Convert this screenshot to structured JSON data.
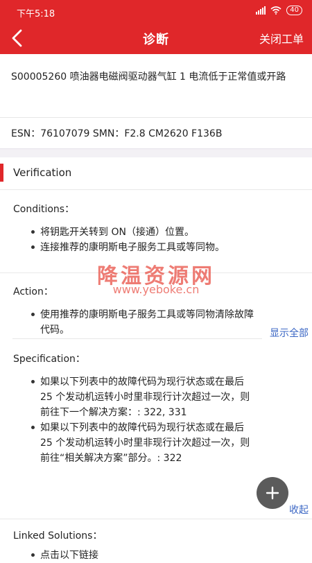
{
  "status": {
    "time": "下午5:18",
    "battery": "40"
  },
  "header": {
    "title": "诊断",
    "close_label": "关闭工单"
  },
  "fault": {
    "description": "S00005260 喷油器电磁阀驱动器气缸 1 电流低于正常值或开路",
    "esn_line": "ESN：76107079 SMN：F2.8 CM2620 F136B"
  },
  "section": {
    "title": "Verification"
  },
  "conditions": {
    "label": "Conditions：",
    "items": [
      "将钥匙开关转到 ON（接通）位置。",
      "连接推荐的康明斯电子服务工具或等同物。"
    ]
  },
  "action": {
    "label": "Action：",
    "items": [
      "使用推荐的康明斯电子服务工具或等同物清除故障代码。"
    ],
    "show_all": "显示全部"
  },
  "specification": {
    "label": "Specification：",
    "items": [
      "如果以下列表中的故障代码为现行状态或在最后 25 个发动机运转小时里非现行计次超过一次，则前往下一个解决方案：: 322, 331",
      "如果以下列表中的故障代码为现行状态或在最后 25 个发动机运转小时里非现行计次超过一次，则前往“相关解决方案”部分。: 322"
    ],
    "collapse": "收起"
  },
  "linked": {
    "label": "Linked Solutions：",
    "partial": "点击以下链接"
  },
  "watermark": {
    "text": "降温资源网",
    "url": "www.yeboke.cn"
  },
  "fab": {
    "icon": "plus-icon"
  },
  "colors": {
    "brand_red": "#e0272a",
    "link_blue": "#3a66c4",
    "fab_gray": "#5b5b5b"
  }
}
